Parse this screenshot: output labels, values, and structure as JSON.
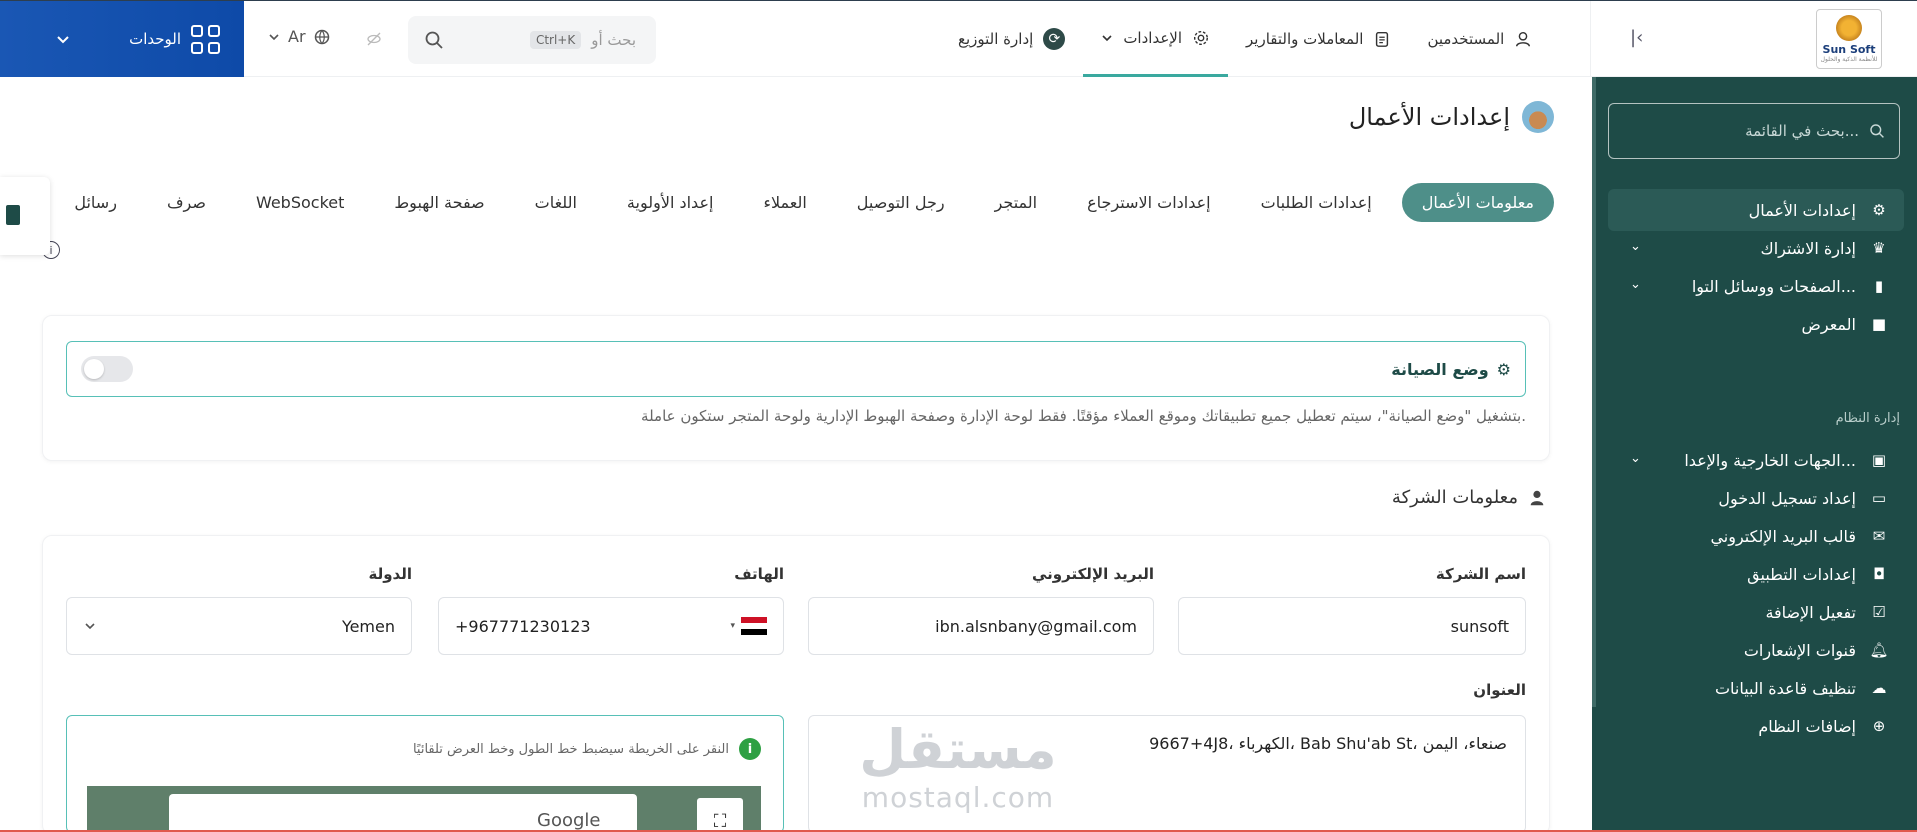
{
  "topbar": {
    "units_label": "الوحدات",
    "lang_label": "Ar",
    "search_placeholder": "بحث أو",
    "search_shortcut": "Ctrl+K",
    "nav": [
      {
        "label": "المستخدمين"
      },
      {
        "label": "المعاملات والتقارير"
      },
      {
        "label": "الإعدادات"
      },
      {
        "label": "إدارة التوزيع"
      }
    ]
  },
  "logo": {
    "name": "Sun Soft",
    "tagline": "للأنظمة الذكية والحلول"
  },
  "sidebar": {
    "search_placeholder": "بحث في القائمة...",
    "items": [
      {
        "label": "إعدادات الأعمال",
        "icon": "gear-icon"
      },
      {
        "label": "إدارة الاشتراك",
        "icon": "crown-icon"
      },
      {
        "label": "الصفحات ووسائل التوا...",
        "icon": "book-icon"
      },
      {
        "label": "المعرض",
        "icon": "bookmark-icon"
      }
    ],
    "section_title": "إدارة النظام",
    "system_items": [
      {
        "label": "الجهات الخارجية والإعدا...",
        "icon": "contact-icon"
      },
      {
        "label": "إعداد تسجيل الدخول",
        "icon": "devices-icon"
      },
      {
        "label": "قالب البريد الإلكتروني",
        "icon": "mail-icon"
      },
      {
        "label": "إعدادات التطبيق",
        "icon": "android-icon"
      },
      {
        "label": "تفعيل الإضافة",
        "icon": "calendar-check-icon"
      },
      {
        "label": "قنوات الإشعارات",
        "icon": "bell-icon"
      },
      {
        "label": "تنظيف قاعدة البيانات",
        "icon": "cloud-icon"
      },
      {
        "label": "إضافات النظام",
        "icon": "plus-circle-icon"
      }
    ]
  },
  "page": {
    "title": "إعدادات الأعمال",
    "tabs": [
      {
        "label": "معلومات الأعمال",
        "active": true
      },
      {
        "label": "إعدادات الطلبات"
      },
      {
        "label": "إعدادات الاسترجاع"
      },
      {
        "label": "المتجر"
      },
      {
        "label": "رجل التوصيل"
      },
      {
        "label": "العملاء"
      },
      {
        "label": "إعداد الأولوية"
      },
      {
        "label": "اللغات"
      },
      {
        "label": "صفحة الهبوط"
      },
      {
        "label": "WebSocket"
      },
      {
        "label": "صرف"
      },
      {
        "label": "رسائل"
      }
    ]
  },
  "maintenance": {
    "title": "وضع الصيانة",
    "enabled": false,
    "description": "بتشغيل \"وضع الصيانة\"، سيتم تعطيل جميع تطبيقاتك وموقع العملاء مؤقتًا. فقط لوحة الإدارة وصفحة الهبوط الإدارية ولوحة المتجر ستكون عاملة."
  },
  "company": {
    "section_title": "معلومات الشركة",
    "labels": {
      "name": "اسم الشركة",
      "email": "البريد الإلكتروني",
      "phone": "الهاتف",
      "country": "الدولة",
      "address": "العنوان"
    },
    "values": {
      "name": "sunsoft",
      "email": "ibn.alsnbany@gmail.com",
      "phone": "+967771230123",
      "country": "Yemen",
      "address": "9667+4J8، الكهرباء، Bab Shu'ab St، صنعاء، اليمن"
    },
    "map_hint": "النقر على الخريطة سيضبط خط الطول وخط العرض تلقائيًا",
    "map_provider": "Google"
  },
  "watermark": {
    "ar": "مستقل",
    "en": "mostaql.com"
  },
  "colors": {
    "primary": "#1e4b47",
    "accent": "#4e8f89",
    "brand_blue": "#1a57b4"
  }
}
